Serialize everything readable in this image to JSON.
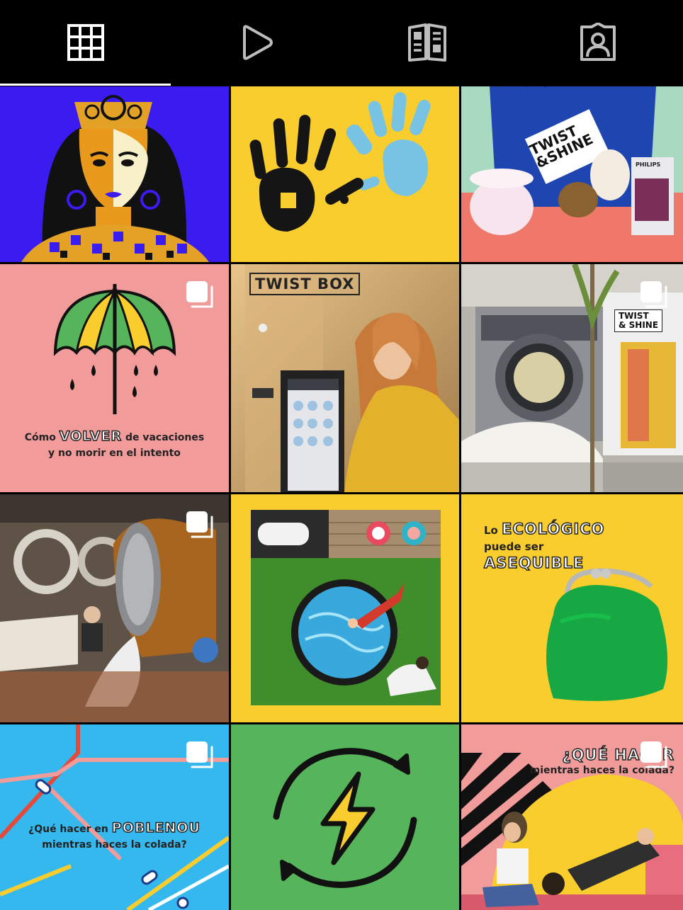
{
  "tabs": [
    {
      "icon": "grid-icon",
      "active": true
    },
    {
      "icon": "reels-play-icon",
      "active": false
    },
    {
      "icon": "guide-book-icon",
      "active": false
    },
    {
      "icon": "tagged-user-icon",
      "active": false
    }
  ],
  "colors": {
    "yellow": "#f9cd2d",
    "pink": "#f29b9b",
    "blue_violet": "#3b1cf0",
    "cyan": "#35b8ee",
    "green": "#56b45a"
  },
  "posts": {
    "p3": {
      "bag_text_1": "TWIST",
      "bag_text_2": "&SHINE",
      "box_text": "PHILIPS"
    },
    "p4": {
      "line1_pre": "Cómo",
      "line1_big": "VOLVER",
      "line1_post": "de vacaciones",
      "line2": "y no morir en el intento"
    },
    "p5": {
      "sign": "TWIST BOX"
    },
    "p6": {
      "sign_1": "TWIST",
      "sign_2": "& SHINE"
    },
    "p9": {
      "line1_pre": "Lo",
      "line1_big": "ECOLÓGICO",
      "line2": "puede ser",
      "line3_big": "ASEQUIBLE"
    },
    "p10": {
      "line1_pre": "¿Qué hacer en",
      "line1_big": "POBLENOU",
      "line2": "mientras haces la colada?"
    },
    "p12": {
      "line1_big": "¿QUÉ HACER",
      "line2": "mientras haces la colada?"
    }
  }
}
